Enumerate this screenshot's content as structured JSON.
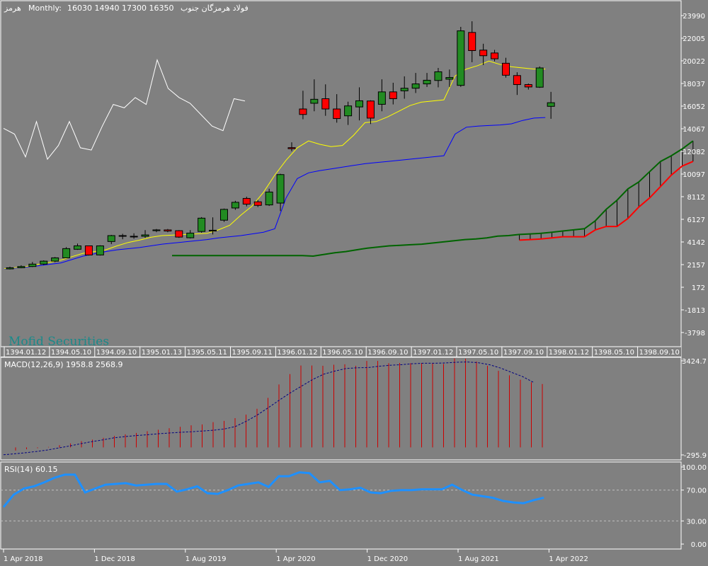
{
  "header": {
    "symbol": "هرمز",
    "timeframe": "Monthly:",
    "ohlc": "16030 14940 17300 16350",
    "name": "فولاد هرمزگان جنوب"
  },
  "watermark": "Mofid Securities",
  "colors": {
    "background": "#808080",
    "bull": "#228b22",
    "bear": "#ff0000",
    "ma_fast": "#ffff00",
    "ma_slow": "#0000ff",
    "white_line": "#ffffff",
    "cloud_top": "#006400",
    "cloud_bottom": "#ff0000",
    "macd_hist": "#cc0000",
    "macd_signal": "#000080",
    "rsi": "#1e90ff"
  },
  "main": {
    "price_ticks": [
      "23990",
      "22005",
      "20022",
      "18037",
      "16052",
      "14067",
      "12082",
      "10097",
      "8112",
      "6127",
      "4142",
      "2157",
      "172",
      "-1813",
      "-3798"
    ],
    "date_labels": [
      "1394.01.12",
      "1394.05.10",
      "1394.09.10",
      "1395.01.13",
      "1395.05.11",
      "1395.09.11",
      "1396.01.12",
      "1396.05.10",
      "1396.09.10",
      "1397.01.12",
      "1397.05.10",
      "1397.09.10",
      "1398.01.12",
      "1398.05.10",
      "1398.09.10"
    ]
  },
  "macd": {
    "label": "MACD(12,26,9) 1958.8 2568.9",
    "ticks": [
      "3424.7",
      "-295.9"
    ]
  },
  "rsi": {
    "label": "RSI(14) 60.15",
    "ticks": [
      "100.00",
      "70.00",
      "30.00",
      "0.00"
    ]
  },
  "bottom_axis": [
    "1 Apr 2018",
    "1 Dec 2018",
    "1 Aug 2019",
    "1 Apr 2020",
    "1 Dec 2020",
    "1 Aug 2021",
    "1 Apr 2022"
  ],
  "chart_data": [
    {
      "type": "candlestick",
      "title": "فولاد هرمزگان جنوب",
      "ylim": [
        -4700,
        24800
      ],
      "candles": [
        {
          "o": 1780,
          "h": 1980,
          "l": 1730,
          "c": 1880
        },
        {
          "o": 1880,
          "h": 2100,
          "l": 1840,
          "c": 1990
        },
        {
          "o": 1990,
          "h": 2390,
          "l": 1940,
          "c": 2200
        },
        {
          "o": 2200,
          "h": 2530,
          "l": 2120,
          "c": 2460
        },
        {
          "o": 2460,
          "h": 2820,
          "l": 2370,
          "c": 2750
        },
        {
          "o": 2750,
          "h": 3690,
          "l": 2720,
          "c": 3560
        },
        {
          "o": 3500,
          "h": 4000,
          "l": 3450,
          "c": 3800
        },
        {
          "o": 3800,
          "h": 3830,
          "l": 2950,
          "c": 3000
        },
        {
          "o": 3000,
          "h": 3850,
          "l": 2950,
          "c": 3800
        },
        {
          "o": 4180,
          "h": 4760,
          "l": 3950,
          "c": 4700
        },
        {
          "o": 4700,
          "h": 4860,
          "l": 4380,
          "c": 4640
        },
        {
          "o": 4640,
          "h": 4900,
          "l": 4430,
          "c": 4640
        },
        {
          "o": 4640,
          "h": 5180,
          "l": 4490,
          "c": 4760
        },
        {
          "o": 5130,
          "h": 5280,
          "l": 5000,
          "c": 5200
        },
        {
          "o": 5200,
          "h": 5280,
          "l": 5000,
          "c": 5100
        },
        {
          "o": 5130,
          "h": 5180,
          "l": 4500,
          "c": 4570
        },
        {
          "o": 4510,
          "h": 5180,
          "l": 4450,
          "c": 4920
        },
        {
          "o": 5060,
          "h": 6320,
          "l": 4950,
          "c": 6230
        },
        {
          "o": 5100,
          "h": 6300,
          "l": 4800,
          "c": 5170
        },
        {
          "o": 6050,
          "h": 7070,
          "l": 5900,
          "c": 7000
        },
        {
          "o": 7120,
          "h": 7750,
          "l": 6960,
          "c": 7620
        },
        {
          "o": 7960,
          "h": 8110,
          "l": 7260,
          "c": 7460
        },
        {
          "o": 7660,
          "h": 7830,
          "l": 7200,
          "c": 7350
        },
        {
          "o": 7390,
          "h": 8810,
          "l": 7300,
          "c": 8520
        },
        {
          "o": 7550,
          "h": 10120,
          "l": 6850,
          "c": 10050
        },
        {
          "o": 12410,
          "h": 12880,
          "l": 12100,
          "c": 12320
        },
        {
          "o": 15800,
          "h": 17400,
          "l": 14900,
          "c": 15320
        },
        {
          "o": 16300,
          "h": 18400,
          "l": 15600,
          "c": 16650
        },
        {
          "o": 16700,
          "h": 17960,
          "l": 15200,
          "c": 15800
        },
        {
          "o": 15800,
          "h": 17100,
          "l": 14600,
          "c": 14960
        },
        {
          "o": 15200,
          "h": 16440,
          "l": 14400,
          "c": 16070
        },
        {
          "o": 15980,
          "h": 17700,
          "l": 14800,
          "c": 16520
        },
        {
          "o": 16500,
          "h": 16560,
          "l": 14480,
          "c": 15000
        },
        {
          "o": 16210,
          "h": 18400,
          "l": 15600,
          "c": 17300
        },
        {
          "o": 17300,
          "h": 18100,
          "l": 16200,
          "c": 16700
        },
        {
          "o": 17390,
          "h": 18660,
          "l": 16700,
          "c": 17620
        },
        {
          "o": 17620,
          "h": 18960,
          "l": 17200,
          "c": 18000
        },
        {
          "o": 18000,
          "h": 18960,
          "l": 17730,
          "c": 18320
        },
        {
          "o": 18300,
          "h": 19400,
          "l": 17700,
          "c": 19060
        },
        {
          "o": 18410,
          "h": 19260,
          "l": 17730,
          "c": 18560
        },
        {
          "o": 17870,
          "h": 23000,
          "l": 17740,
          "c": 22650
        },
        {
          "o": 22510,
          "h": 23490,
          "l": 19900,
          "c": 20920
        },
        {
          "o": 20960,
          "h": 21520,
          "l": 19650,
          "c": 20470
        },
        {
          "o": 20710,
          "h": 20980,
          "l": 19980,
          "c": 20200
        },
        {
          "o": 19810,
          "h": 20290,
          "l": 18550,
          "c": 18760
        },
        {
          "o": 18730,
          "h": 19020,
          "l": 17030,
          "c": 17940
        },
        {
          "o": 17940,
          "h": 18030,
          "l": 17500,
          "c": 17730
        },
        {
          "o": 17710,
          "h": 19530,
          "l": 17650,
          "c": 19400
        },
        {
          "o": 16030,
          "h": 17300,
          "l": 14940,
          "c": 16350
        }
      ]
    },
    {
      "type": "line",
      "xlabel": "",
      "ylabel": "MACD(12,26,9)",
      "ylim": [
        -295.9,
        3424.7
      ],
      "histogram": [
        -125,
        -70,
        -30,
        20,
        90,
        157,
        250,
        310,
        380,
        455,
        520,
        575,
        640,
        700,
        760,
        815,
        875,
        910,
        1000,
        1050,
        1160,
        1300,
        1530,
        1960,
        2490,
        2900,
        3240,
        3240,
        3230,
        3270,
        3290,
        3230,
        3420,
        3420,
        3330,
        3340,
        3330,
        3340,
        3330,
        3300,
        3520,
        3510,
        3400,
        3230,
        3030,
        2850,
        2680,
        2580,
        2510
      ],
      "signal": [
        -290,
        -250,
        -210,
        -160,
        -100,
        -20,
        60,
        150,
        230,
        300,
        380,
        430,
        470,
        500,
        540,
        570,
        600,
        620,
        650,
        680,
        730,
        830,
        1040,
        1290,
        1580,
        1880,
        2170,
        2430,
        2690,
        2900,
        3020,
        3120,
        3150,
        3160,
        3210,
        3250,
        3270,
        3310,
        3330,
        3330,
        3340,
        3370,
        3380,
        3350,
        3270,
        3140,
        2970,
        2800,
        2570
      ]
    },
    {
      "type": "line",
      "ylabel": "RSI(14)",
      "ylim": [
        0,
        100
      ],
      "values": [
        48,
        64,
        72,
        75,
        80,
        86,
        90,
        90,
        67,
        72,
        77,
        78,
        79,
        76,
        77,
        78,
        78,
        68,
        71,
        75,
        66,
        65,
        70,
        76,
        78,
        80,
        74,
        88,
        88,
        93,
        92,
        80,
        82,
        70,
        71,
        73,
        67,
        66,
        69,
        70,
        70,
        71,
        71,
        71,
        77,
        70,
        64,
        62,
        60,
        56,
        54,
        53,
        57,
        60.15
      ]
    }
  ]
}
